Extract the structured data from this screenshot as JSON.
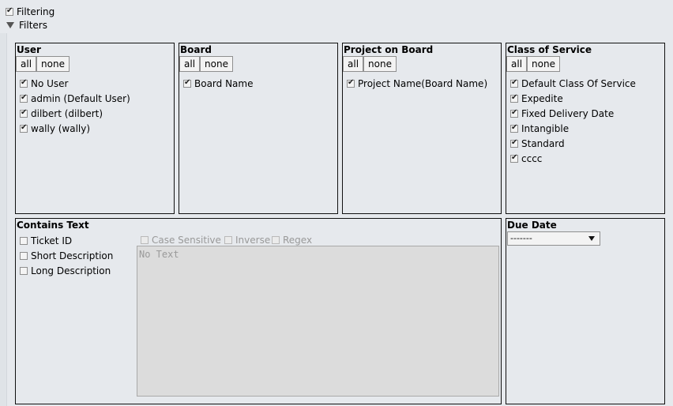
{
  "filtering": {
    "label": "Filtering",
    "checked": true
  },
  "filters": {
    "label": "Filters"
  },
  "buttons": {
    "all": "all",
    "none": "none"
  },
  "user_panel": {
    "title": "User",
    "items": [
      {
        "label": "No User",
        "checked": true
      },
      {
        "label": "admin (Default User)",
        "checked": true
      },
      {
        "label": "dilbert (dilbert)",
        "checked": true
      },
      {
        "label": "wally (wally)",
        "checked": true
      }
    ]
  },
  "board_panel": {
    "title": "Board",
    "items": [
      {
        "label": "Board Name",
        "checked": true
      }
    ]
  },
  "project_panel": {
    "title": "Project on Board",
    "items": [
      {
        "label": "Project Name(Board Name)",
        "checked": true
      }
    ]
  },
  "cos_panel": {
    "title": "Class of Service",
    "items": [
      {
        "label": "Default Class Of Service",
        "checked": true
      },
      {
        "label": "Expedite",
        "checked": true
      },
      {
        "label": "Fixed Delivery Date",
        "checked": true
      },
      {
        "label": "Intangible",
        "checked": true
      },
      {
        "label": "Standard",
        "checked": true
      },
      {
        "label": "cccc",
        "checked": true
      }
    ]
  },
  "contains_text": {
    "title": "Contains Text",
    "fields": [
      {
        "label": "Ticket ID",
        "checked": false
      },
      {
        "label": "Short Description",
        "checked": false
      },
      {
        "label": "Long Description",
        "checked": false
      }
    ],
    "options": [
      {
        "label": "Case Sensitive",
        "checked": false
      },
      {
        "label": "Inverse",
        "checked": false
      },
      {
        "label": "Regex",
        "checked": false
      }
    ],
    "placeholder": "No Text"
  },
  "due_date": {
    "title": "Due Date",
    "selected": "-------"
  }
}
